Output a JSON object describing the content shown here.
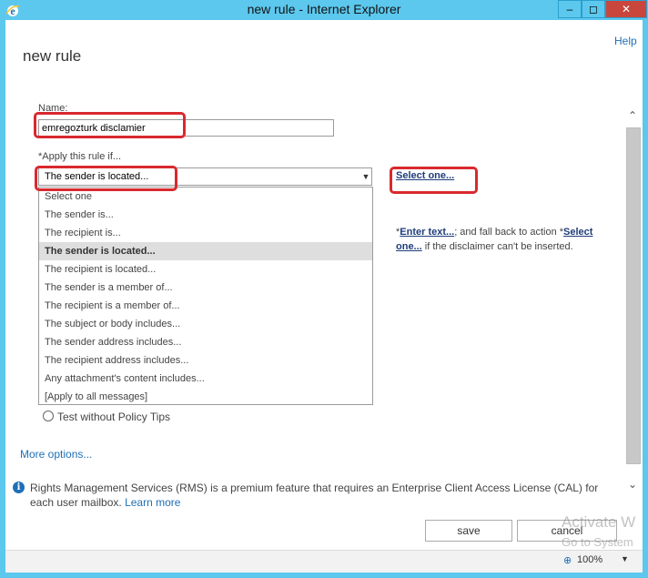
{
  "window": {
    "title": "new rule - Internet Explorer",
    "min": "–",
    "max": "◻",
    "close": "✕"
  },
  "header": {
    "help": "Help",
    "page_title": "new rule"
  },
  "form": {
    "name_label": "Name:",
    "name_value": "emregozturk disclamier",
    "apply_label": "*Apply this rule if...",
    "select_value": "The sender is located...",
    "select_one": "Select one...",
    "dropdown_items": [
      "Select one",
      "The sender is...",
      "The recipient is...",
      "The sender is located...",
      "The recipient is located...",
      "The sender is a member of...",
      "The recipient is a member of...",
      "The subject or body includes...",
      "The sender address includes...",
      "The recipient address includes...",
      "Any attachment's content includes...",
      "[Apply to all messages]"
    ],
    "selected_index": 3,
    "action_prefix": "*",
    "action_enter_text": "Enter text...",
    "action_middle": "; and fall back to action *",
    "action_select_one": "Select one...",
    "action_suffix": " if the disclaimer can't be inserted.",
    "radio_label": "Test without Policy Tips",
    "more_options": "More options..."
  },
  "info": {
    "text": "Rights Management Services (RMS) is a premium feature that requires an Enterprise Client Access License (CAL) for each user mailbox. ",
    "link": "Learn more"
  },
  "buttons": {
    "save": "save",
    "cancel": "cancel"
  },
  "status": {
    "zoom": "100%"
  },
  "watermark": {
    "line1": "Activate W",
    "line2": "Go to System"
  },
  "colors": {
    "accent": "#5cc8ee",
    "link": "#1f6fb6",
    "highlight": "#d9292e"
  }
}
